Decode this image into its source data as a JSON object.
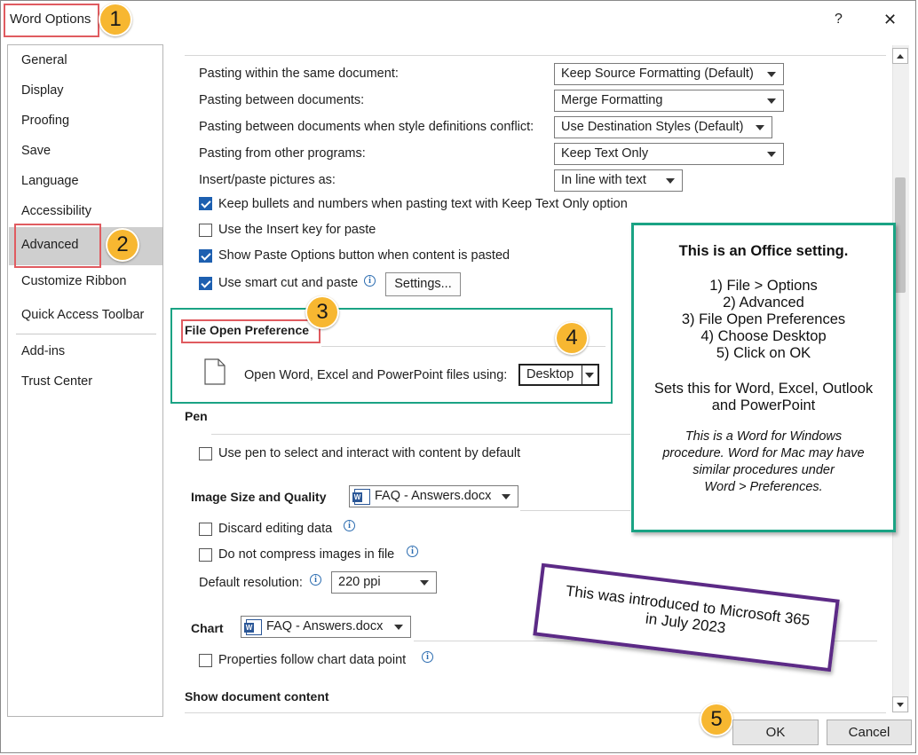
{
  "dialog": {
    "title": "Word Options",
    "help_icon": "?",
    "close_icon": "✕"
  },
  "nav": {
    "items": [
      "General",
      "Display",
      "Proofing",
      "Save",
      "Language",
      "Accessibility",
      "Advanced",
      "Customize Ribbon",
      "Quick Access Toolbar",
      "Add-ins",
      "Trust Center"
    ],
    "selected": "Advanced"
  },
  "cut_copy_paste": {
    "within_doc_label": "Pasting within the same document:",
    "within_doc_value": "Keep Source Formatting (Default)",
    "between_docs_label": "Pasting between documents:",
    "between_docs_value": "Merge Formatting",
    "conflict_label": "Pasting between documents when style definitions conflict:",
    "conflict_value": "Use Destination Styles (Default)",
    "other_programs_label": "Pasting from other programs:",
    "other_programs_value": "Keep Text Only",
    "pictures_label": "Insert/paste pictures as:",
    "pictures_value": "In line with text",
    "keep_bullets_label": "Keep bullets and numbers when pasting text with Keep Text Only option",
    "keep_bullets_checked": true,
    "insert_key_label": "Use the Insert key for paste",
    "insert_key_checked": false,
    "show_paste_label": "Show Paste Options button when content is pasted",
    "show_paste_checked": true,
    "smart_cut_label": "Use smart cut and paste",
    "smart_cut_checked": true,
    "settings_button": "Settings..."
  },
  "file_open": {
    "heading": "File Open Preference",
    "label": "Open Word, Excel and PowerPoint files using:",
    "value": "Desktop"
  },
  "pen": {
    "heading": "Pen",
    "use_pen_label": "Use pen to select and interact with content by default",
    "use_pen_checked": false
  },
  "image": {
    "heading": "Image Size and Quality",
    "doc_value": "FAQ - Answers.docx",
    "discard_label": "Discard editing data",
    "discard_checked": false,
    "compress_label": "Do not compress images in file",
    "compress_checked": false,
    "resolution_label": "Default resolution:",
    "resolution_value": "220 ppi"
  },
  "chart": {
    "heading": "Chart",
    "doc_value": "FAQ - Answers.docx",
    "props_label": "Properties follow chart data point",
    "props_checked": false
  },
  "show_doc": {
    "heading": "Show document content"
  },
  "buttons": {
    "ok": "OK",
    "cancel": "Cancel"
  },
  "badges": [
    "1",
    "2",
    "3",
    "4",
    "5"
  ],
  "callout": {
    "title": "This is an Office setting.",
    "step1": "1) File > Options",
    "step2": "2) Advanced",
    "step3": "3) File Open Preferences",
    "step4": "4) Choose Desktop",
    "step5": "5) Click on OK",
    "sets1": "Sets this for Word, Excel, Outlook",
    "sets2": "and PowerPoint",
    "note1": "This is a Word for Windows",
    "note2": "procedure. Word for Mac may have",
    "note3": "similar procedures under",
    "note4": "Word > Preferences."
  },
  "note_box": {
    "line1": "This was introduced to Microsoft 365",
    "line2": "in July 2023"
  },
  "colors": {
    "accent_teal": "#1aa384",
    "badge": "#f7b731",
    "highlight_red": "#e05b60",
    "note_purple": "#5c2a86",
    "check_blue": "#1d5fb0"
  }
}
